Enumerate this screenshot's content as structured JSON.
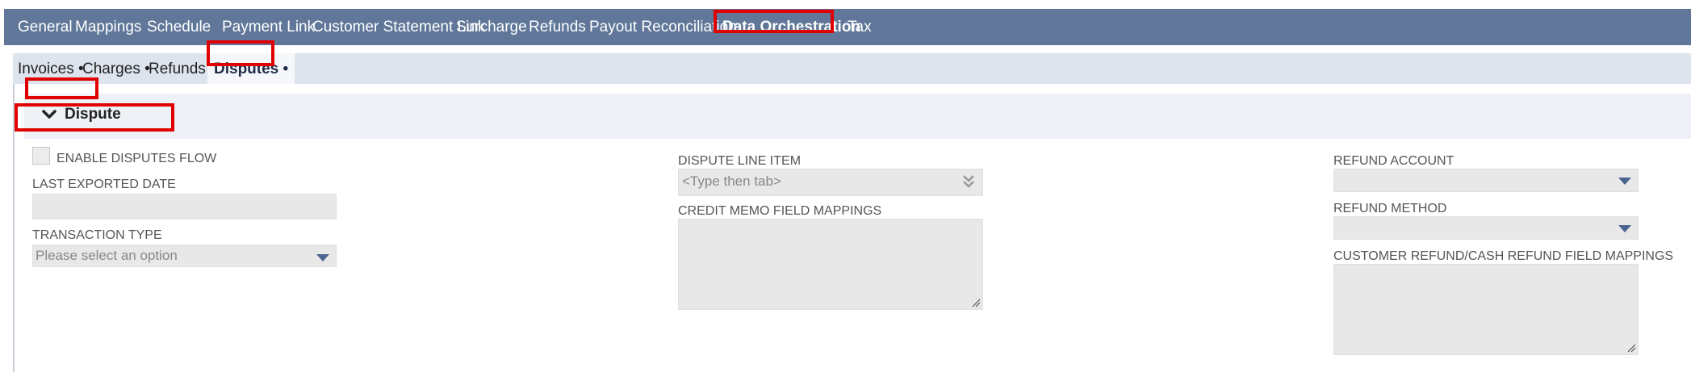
{
  "top_nav": {
    "tabs": [
      {
        "label": "General"
      },
      {
        "label": "Mappings"
      },
      {
        "label": "Schedule"
      },
      {
        "label": "Payment Link"
      },
      {
        "label": "Customer Statement Link"
      },
      {
        "label": "Surcharge"
      },
      {
        "label": "Refunds"
      },
      {
        "label": "Payout Reconciliation"
      },
      {
        "label": "Data Orchestration"
      },
      {
        "label": "Tax"
      }
    ],
    "active": "Data Orchestration"
  },
  "sub_nav": {
    "tabs": [
      {
        "label": "Invoices •"
      },
      {
        "label": "Charges •"
      },
      {
        "label": "Refunds •"
      },
      {
        "label": "Disputes •"
      }
    ],
    "active": "Disputes •"
  },
  "section": {
    "title": "Dispute"
  },
  "fields": {
    "enable_disputes": {
      "label": "ENABLE DISPUTES FLOW",
      "checked": false
    },
    "last_exported_date": {
      "label": "LAST EXPORTED DATE",
      "value": ""
    },
    "transaction_type": {
      "label": "TRANSACTION TYPE",
      "placeholder": "Please select an option"
    },
    "dispute_line_item": {
      "label": "DISPUTE LINE ITEM",
      "placeholder": "<Type then tab>"
    },
    "credit_memo_mappings": {
      "label": "CREDIT MEMO FIELD MAPPINGS",
      "value": ""
    },
    "refund_account": {
      "label": "REFUND ACCOUNT",
      "value": ""
    },
    "refund_method": {
      "label": "REFUND METHOD",
      "value": ""
    },
    "customer_refund_mappings": {
      "label": "CUSTOMER REFUND/CASH REFUND FIELD MAPPINGS",
      "value": ""
    }
  },
  "colors": {
    "nav_bg": "#607799",
    "subnav_bg": "#dde4ee",
    "highlight": "#e00000",
    "field_bg": "#e8e8e8"
  }
}
